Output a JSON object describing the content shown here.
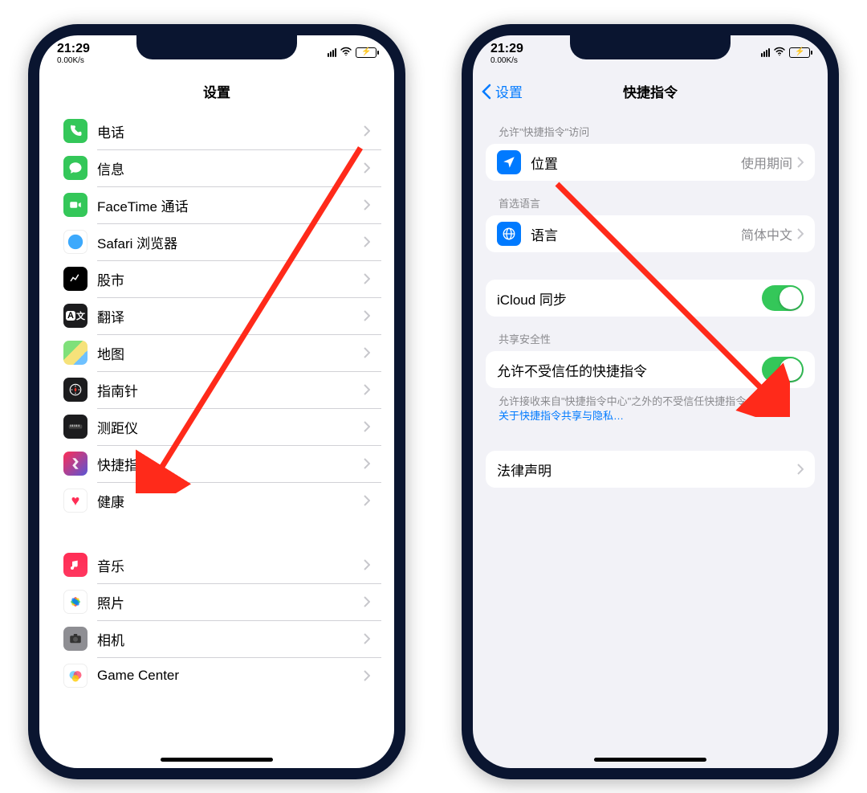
{
  "status": {
    "time": "21:29",
    "net_speed": "0.00K/s"
  },
  "left_phone": {
    "title": "设置",
    "group1": [
      {
        "id": "phone",
        "label": "电话"
      },
      {
        "id": "messages",
        "label": "信息"
      },
      {
        "id": "facetime",
        "label": "FaceTime 通话"
      },
      {
        "id": "safari",
        "label": "Safari 浏览器"
      },
      {
        "id": "stocks",
        "label": "股市"
      },
      {
        "id": "translate",
        "label": "翻译"
      },
      {
        "id": "maps",
        "label": "地图"
      },
      {
        "id": "compass",
        "label": "指南针"
      },
      {
        "id": "measure",
        "label": "测距仪"
      },
      {
        "id": "shortcuts",
        "label": "快捷指令"
      },
      {
        "id": "health",
        "label": "健康"
      }
    ],
    "group2": [
      {
        "id": "music",
        "label": "音乐"
      },
      {
        "id": "photos",
        "label": "照片"
      },
      {
        "id": "camera",
        "label": "相机"
      },
      {
        "id": "gamecenter",
        "label": "Game Center"
      }
    ]
  },
  "right_phone": {
    "back": "设置",
    "title": "快捷指令",
    "sec_access_header": "允许\"快捷指令\"访问",
    "location": {
      "label": "位置",
      "value": "使用期间"
    },
    "sec_lang_header": "首选语言",
    "language": {
      "label": "语言",
      "value": "简体中文"
    },
    "icloud_label": "iCloud 同步",
    "sec_security_header": "共享安全性",
    "untrusted_label": "允许不受信任的快捷指令",
    "footer_text": "允许接收来自\"快捷指令中心\"之外的不受信任快捷指令。",
    "footer_link": "关于快捷指令共享与隐私…",
    "legal_label": "法律声明"
  }
}
